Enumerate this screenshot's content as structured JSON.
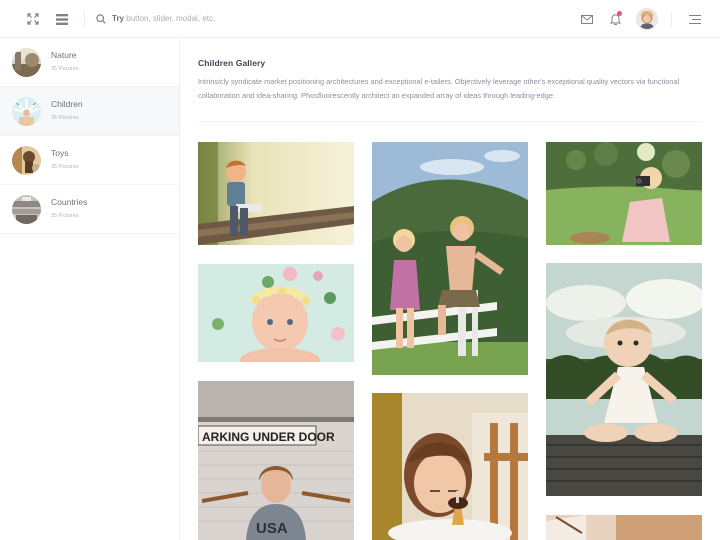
{
  "header": {
    "search": {
      "hint_bold": "Try",
      "hint_rest": " button, slider, modal, etc.",
      "value": ""
    },
    "icons": [
      "expand-icon",
      "menu-icon",
      "search-icon",
      "mail-icon",
      "bell-icon",
      "hamburger-icon"
    ],
    "notification_dot_color": "#f4516c"
  },
  "sidebar": {
    "albums": [
      {
        "name": "Nature",
        "count": "35 Pictures",
        "active": false
      },
      {
        "name": "Children",
        "count": "35 Pictures",
        "active": true
      },
      {
        "name": "Toys",
        "count": "35 Pictures",
        "active": false
      },
      {
        "name": "Countries",
        "count": "35 Pictures",
        "active": false
      }
    ]
  },
  "gallery": {
    "title": "Children Gallery",
    "description": "Intrinsicly syndicate market positioning architectures and exceptional e-tailers. Objectively leverage other's exceptional quality vectors via functional collaboration and idea-sharing. Phosfluorescently architect an expanded array of ideas through leading-edge.",
    "photo_sign_text": "ARKING UNDER DOOR",
    "photo_shirt_text": "USA"
  },
  "colors": {
    "background": "#ffffff",
    "sidebar_active": "#f7f8fa",
    "text_primary": "#3c4858",
    "text_muted": "#8a929c"
  }
}
